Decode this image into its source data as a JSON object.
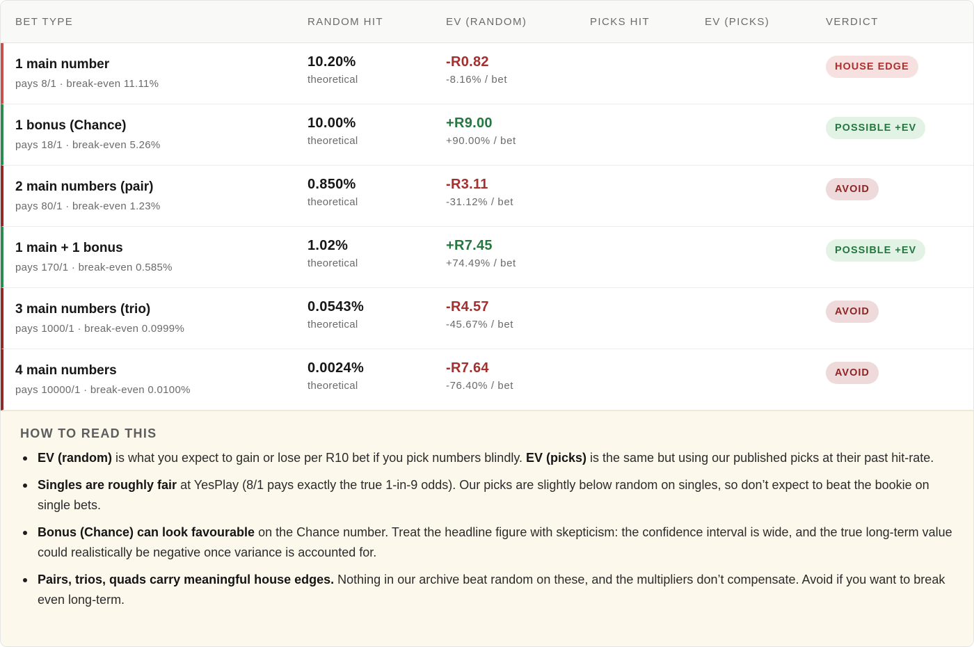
{
  "columns": [
    "BET TYPE",
    "RANDOM HIT",
    "EV (RANDOM)",
    "PICKS HIT",
    "EV (PICKS)",
    "VERDICT"
  ],
  "rows": [
    {
      "name": "1 main number",
      "sub": "pays 8/1 · break-even 11.11%",
      "hit": "10.20%",
      "hit_sub": "theoretical",
      "ev": "-R0.82",
      "ev_sub": "-8.16% / bet",
      "picks_hit": "",
      "ev_picks": "",
      "verdict": "HOUSE EDGE"
    },
    {
      "name": "1 bonus (Chance)",
      "sub": "pays 18/1 · break-even 5.26%",
      "hit": "10.00%",
      "hit_sub": "theoretical",
      "ev": "+R9.00",
      "ev_sub": "+90.00% / bet",
      "picks_hit": "",
      "ev_picks": "",
      "verdict": "POSSIBLE +EV"
    },
    {
      "name": "2 main numbers (pair)",
      "sub": "pays 80/1 · break-even 1.23%",
      "hit": "0.850%",
      "hit_sub": "theoretical",
      "ev": "-R3.11",
      "ev_sub": "-31.12% / bet",
      "picks_hit": "",
      "ev_picks": "",
      "verdict": "AVOID"
    },
    {
      "name": "1 main + 1 bonus",
      "sub": "pays 170/1 · break-even 0.585%",
      "hit": "1.02%",
      "hit_sub": "theoretical",
      "ev": "+R7.45",
      "ev_sub": "+74.49% / bet",
      "picks_hit": "",
      "ev_picks": "",
      "verdict": "POSSIBLE +EV"
    },
    {
      "name": "3 main numbers (trio)",
      "sub": "pays 1000/1 · break-even 0.0999%",
      "hit": "0.0543%",
      "hit_sub": "theoretical",
      "ev": "-R4.57",
      "ev_sub": "-45.67% / bet",
      "picks_hit": "",
      "ev_picks": "",
      "verdict": "AVOID"
    },
    {
      "name": "4 main numbers",
      "sub": "pays 10000/1 · break-even 0.0100%",
      "hit": "0.0024%",
      "hit_sub": "theoretical",
      "ev": "-R7.64",
      "ev_sub": "-76.40% / bet",
      "picks_hit": "",
      "ev_picks": "",
      "verdict": "AVOID"
    }
  ],
  "colors": {
    "negative": "#a3302e",
    "positive": "#23773f",
    "house_edge_accent": "#c2534f",
    "avoid_accent": "#8e2a2a",
    "possible_ev_accent": "#2e8b4f",
    "notes_background": "#fdf8ec"
  },
  "notes": {
    "title": "HOW TO READ THIS",
    "items": [
      {
        "lead": "EV (random)",
        "text1": " is what you expect to gain or lose per R10 bet if you pick numbers blindly. ",
        "lead2": "EV (picks)",
        "text2": " is the same but using our published picks at their past hit-rate."
      },
      {
        "lead": "Singles are roughly fair",
        "text1": " at YesPlay (8/1 pays exactly the true 1-in-9 odds). Our picks are slightly below random on singles, so don’t expect to beat the bookie on single bets.",
        "lead2": "",
        "text2": ""
      },
      {
        "lead": "Bonus (Chance) can look favourable",
        "text1": " on the Chance number. Treat the headline figure with skepticism: the confidence interval is wide, and the true long-term value could realistically be negative once variance is accounted for.",
        "lead2": "",
        "text2": ""
      },
      {
        "lead": "Pairs, trios, quads carry meaningful house edges.",
        "text1": " Nothing in our archive beat random on these, and the multipliers don’t compensate. Avoid if you want to break even long-term.",
        "lead2": "",
        "text2": ""
      }
    ]
  }
}
